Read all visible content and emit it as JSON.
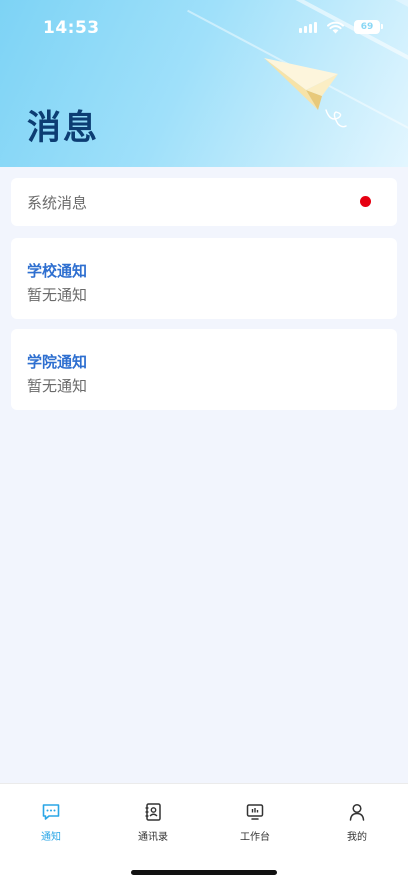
{
  "status_bar": {
    "time": "14:53",
    "battery": "69"
  },
  "header": {
    "title": "消息"
  },
  "system_messages": {
    "label": "系统消息",
    "has_unread": true
  },
  "notices": [
    {
      "title": "学校通知",
      "subtitle": "暂无通知"
    },
    {
      "title": "学院通知",
      "subtitle": "暂无通知"
    }
  ],
  "tabbar": {
    "items": [
      {
        "label": "通知",
        "icon": "chat-bubble-icon",
        "active": true
      },
      {
        "label": "通讯录",
        "icon": "address-book-icon",
        "active": false
      },
      {
        "label": "工作台",
        "icon": "monitor-icon",
        "active": false
      },
      {
        "label": "我的",
        "icon": "person-icon",
        "active": false
      }
    ]
  },
  "colors": {
    "accent": "#2aa6e6",
    "title_text": "#0d3d73",
    "notice_title": "#2e6fd0",
    "unread_dot": "#e60012"
  }
}
